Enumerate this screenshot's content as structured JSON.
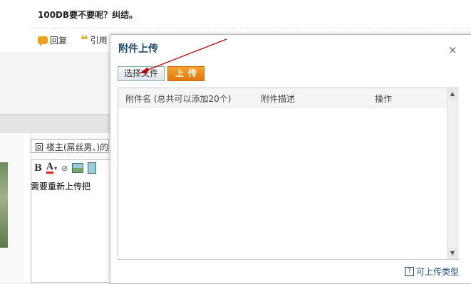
{
  "post": {
    "text": "100DB要不要呢？纠结。",
    "reply_label": "回复",
    "quote_label": "引用"
  },
  "editor": {
    "reply_select_value": "回  楼主(屌丝男、)的",
    "toolbar": {
      "bold": "B",
      "font_color": "A",
      "color_arrow": "▾",
      "link": "⊘"
    },
    "content": "需要重新上传把"
  },
  "dialog": {
    "title": "附件上传",
    "close": "×",
    "choose_file_label": "选择文件",
    "upload_label": "上传",
    "columns": {
      "name": "附件名 (总共可以添加20个)",
      "description": "附件描述",
      "operation": "操作"
    },
    "scroll_up": "▲",
    "scroll_down": "▼",
    "help_icon": "?",
    "allowed_types_link": "可上传类型"
  },
  "colors": {
    "accent_orange": "#e07808",
    "title_blue": "#1a4a70",
    "annotation_red": "#c00000"
  }
}
